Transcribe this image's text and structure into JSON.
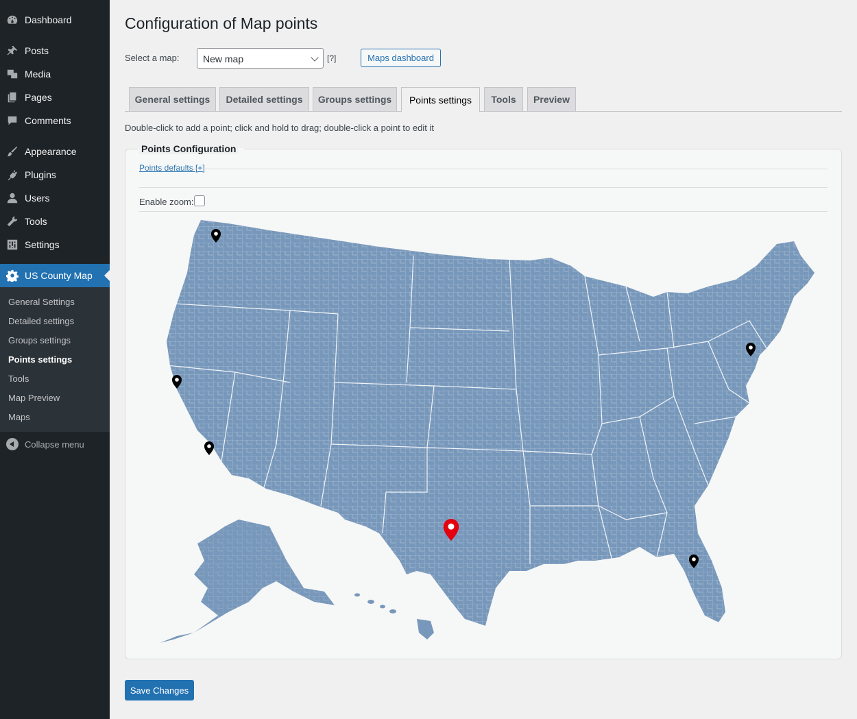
{
  "sidebar": {
    "items": [
      {
        "label": "Dashboard",
        "icon": "dashboard-icon"
      },
      {
        "label": "Posts",
        "icon": "pin-icon"
      },
      {
        "label": "Media",
        "icon": "media-icon"
      },
      {
        "label": "Pages",
        "icon": "pages-icon"
      },
      {
        "label": "Comments",
        "icon": "comment-icon"
      },
      {
        "label": "Appearance",
        "icon": "brush-icon"
      },
      {
        "label": "Plugins",
        "icon": "plugin-icon"
      },
      {
        "label": "Users",
        "icon": "user-icon"
      },
      {
        "label": "Tools",
        "icon": "wrench-icon"
      },
      {
        "label": "Settings",
        "icon": "settings-icon"
      },
      {
        "label": "US County Map",
        "icon": "gear-icon"
      }
    ],
    "submenu": [
      {
        "label": "General Settings"
      },
      {
        "label": "Detailed settings"
      },
      {
        "label": "Groups settings"
      },
      {
        "label": "Points settings"
      },
      {
        "label": "Tools"
      },
      {
        "label": "Map Preview"
      },
      {
        "label": "Maps"
      }
    ],
    "collapse_label": "Collapse menu"
  },
  "header": {
    "title": "Configuration of Map points",
    "select_label": "Select a map:",
    "select_value": "New map",
    "help": "[?]",
    "dashboard_button": "Maps dashboard"
  },
  "tabs": [
    {
      "label": "General settings"
    },
    {
      "label": "Detailed settings"
    },
    {
      "label": "Groups settings"
    },
    {
      "label": "Points settings"
    },
    {
      "label": "Tools"
    },
    {
      "label": "Preview"
    }
  ],
  "instructions": "Double-click to add a point; click and hold to drag; double-click a point to edit it",
  "panel": {
    "title": "Points Configuration",
    "defaults_link": "Points defaults [+]",
    "zoom_label": "Enable zoom:"
  },
  "map": {
    "fill_color": "#7898bb",
    "border_color": "#ffffff",
    "point_color": "#000000",
    "selected_point_color": "#e3000f",
    "points": [
      {
        "name": "Seattle"
      },
      {
        "name": "San Francisco"
      },
      {
        "name": "Los Angeles"
      },
      {
        "name": "New York"
      },
      {
        "name": "Orlando"
      },
      {
        "name": "San Antonio",
        "selected": true
      }
    ]
  },
  "footer": {
    "save_label": "Save Changes"
  },
  "colors": {
    "accent": "#2271b1",
    "sidebar_bg": "#1d2327",
    "submenu_bg": "#2c3338"
  }
}
